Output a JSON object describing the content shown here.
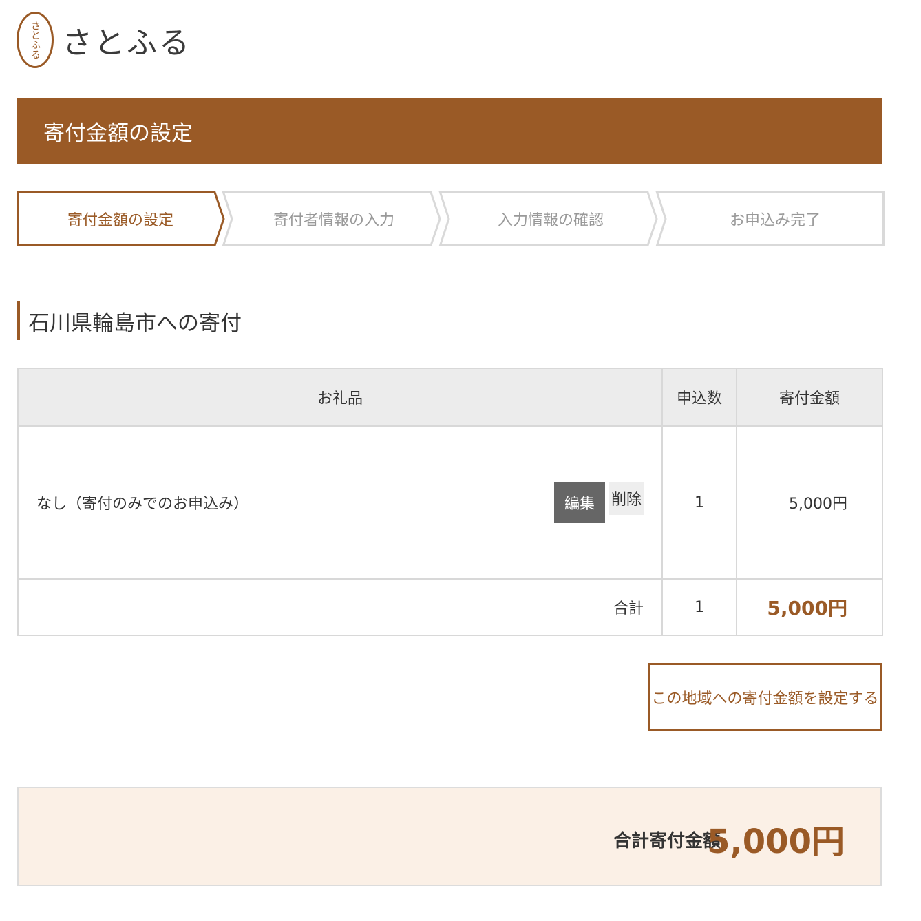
{
  "logo": {
    "mark": "さとふる",
    "text": "さとふる"
  },
  "page_title": "寄付金額の設定",
  "steps": [
    {
      "label": "寄付金額の設定",
      "active": true
    },
    {
      "label": "寄付者情報の入力",
      "active": false
    },
    {
      "label": "入力情報の確認",
      "active": false
    },
    {
      "label": "お申込み完了",
      "active": false
    }
  ],
  "section_title": "石川県輪島市への寄付",
  "table": {
    "headers": {
      "gift": "お礼品",
      "quantity": "申込数",
      "amount": "寄付金額"
    },
    "rows": [
      {
        "gift": "なし（寄付のみでのお申込み）",
        "quantity": "1",
        "amount": "5,000円",
        "edit_label": "編集",
        "delete_label": "削除"
      }
    ],
    "total": {
      "label": "合計",
      "quantity": "1",
      "amount": "5,000円"
    }
  },
  "region_button_label": "この地域への寄付金額を設定する",
  "summary": {
    "label": "合計寄付金額",
    "amount": "5,000円"
  },
  "colors": {
    "accent": "#9a5a26",
    "summary_bg": "#fbf0e6",
    "header_bg": "#ececec"
  }
}
